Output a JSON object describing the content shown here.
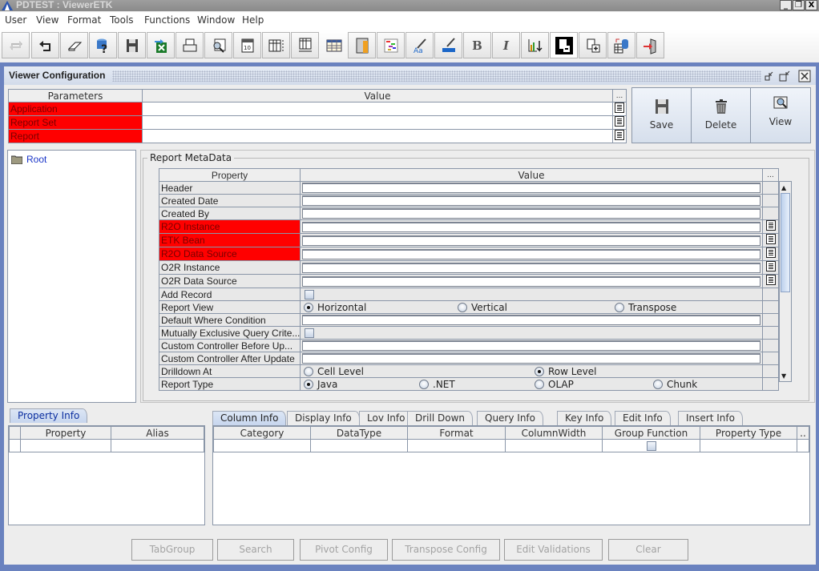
{
  "window": {
    "title": "PDTEST : ViewerETK",
    "controls": [
      "minimize",
      "restore",
      "close"
    ]
  },
  "menu": [
    "User",
    "View",
    "Format",
    "Tools",
    "Functions",
    "Window",
    "Help"
  ],
  "toolbar": [
    {
      "icon": "refresh-icon",
      "tooltip": "Refresh",
      "disabled": true
    },
    {
      "icon": "undo-icon"
    },
    {
      "icon": "eraser-icon"
    },
    {
      "icon": "database-query-icon"
    },
    {
      "icon": "save-icon"
    },
    {
      "icon": "export-excel-icon"
    },
    {
      "icon": "print-icon"
    },
    {
      "icon": "table-search-icon"
    },
    {
      "icon": "calendar-icon"
    },
    {
      "icon": "row-height-icon"
    },
    {
      "icon": "column-width-icon"
    },
    {
      "icon": "grid-icon"
    },
    {
      "icon": "column-highlight-icon"
    },
    {
      "icon": "color-chart-icon"
    },
    {
      "icon": "font-color-icon"
    },
    {
      "icon": "fill-color-icon"
    },
    {
      "icon": "bold-icon",
      "label": "B"
    },
    {
      "icon": "italic-icon",
      "label": "I"
    },
    {
      "icon": "chart-sort-icon"
    },
    {
      "icon": "remove-page-icon"
    },
    {
      "icon": "add-page-icon"
    },
    {
      "icon": "table-database-icon"
    },
    {
      "icon": "exit-icon"
    }
  ],
  "viewer_config": {
    "title": "Viewer Configuration",
    "params_table": {
      "headers": [
        "Parameters",
        "Value",
        "..."
      ],
      "rows": [
        {
          "param": "Application",
          "value": "",
          "required": true
        },
        {
          "param": "Report Set",
          "value": "",
          "required": true
        },
        {
          "param": "Report",
          "value": "",
          "required": true
        }
      ]
    },
    "actions": [
      {
        "label": "Save",
        "icon": "floppy-icon"
      },
      {
        "label": "Delete",
        "icon": "trash-icon"
      },
      {
        "label": "View",
        "icon": "view-icon"
      }
    ]
  },
  "tree": {
    "root": "Root"
  },
  "metadata": {
    "legend": "Report MetaData",
    "headers": [
      "Property",
      "Value",
      "..."
    ],
    "rows": [
      {
        "label": "Header",
        "type": "text",
        "value": ""
      },
      {
        "label": "Created Date",
        "type": "text",
        "value": ""
      },
      {
        "label": "Created By",
        "type": "text",
        "value": ""
      },
      {
        "label": "R2O Instance",
        "type": "text",
        "value": "",
        "required": true,
        "lookup": true
      },
      {
        "label": "ETK Bean",
        "type": "text",
        "value": "",
        "required": true,
        "lookup": true
      },
      {
        "label": "R2O Data Source",
        "type": "text",
        "value": "",
        "required": true,
        "lookup": true
      },
      {
        "label": "O2R Instance",
        "type": "text",
        "value": "",
        "lookup": true
      },
      {
        "label": "O2R Data Source",
        "type": "text",
        "value": "",
        "lookup": true
      },
      {
        "label": "Add Record",
        "type": "checkbox",
        "checked": false
      },
      {
        "label": "Report View",
        "type": "radio",
        "options": [
          "Horizontal",
          "Vertical",
          "Transpose"
        ],
        "selected": "Horizontal"
      },
      {
        "label": "Default Where Condition",
        "type": "text",
        "value": ""
      },
      {
        "label": "Mutually Exclusive Query Crite...",
        "type": "checkbox",
        "checked": false
      },
      {
        "label": "Custom Controller Before Up...",
        "type": "text",
        "value": ""
      },
      {
        "label": "Custom Controller After Update",
        "type": "text",
        "value": ""
      },
      {
        "label": "Drilldown At",
        "type": "radio",
        "options": [
          "Cell Level",
          "Row Level"
        ],
        "selected": "Row Level"
      },
      {
        "label": "Report Type",
        "type": "radio",
        "options": [
          "Java",
          ".NET",
          "OLAP",
          "Chunk"
        ],
        "selected": "Java"
      }
    ]
  },
  "property_info": {
    "tab": "Property Info",
    "headers": [
      "",
      "Property",
      "Alias"
    ]
  },
  "column_tabs": [
    "Column Info",
    "Display Info",
    "Lov Info",
    "Drill Down",
    "Query Info",
    "Key Info",
    "Edit Info",
    "Insert Info"
  ],
  "column_info": {
    "headers": [
      "Category",
      "DataType",
      "Format",
      "ColumnWidth",
      "Group Function",
      "Property Type",
      ".."
    ]
  },
  "bottom_buttons": [
    "TabGroup",
    "Search",
    "Pivot Config",
    "Transpose Config",
    "Edit Validations",
    "Clear"
  ],
  "colors": {
    "required": "#ff0000",
    "frame": "#6a82bf",
    "link": "#1a35c8"
  }
}
